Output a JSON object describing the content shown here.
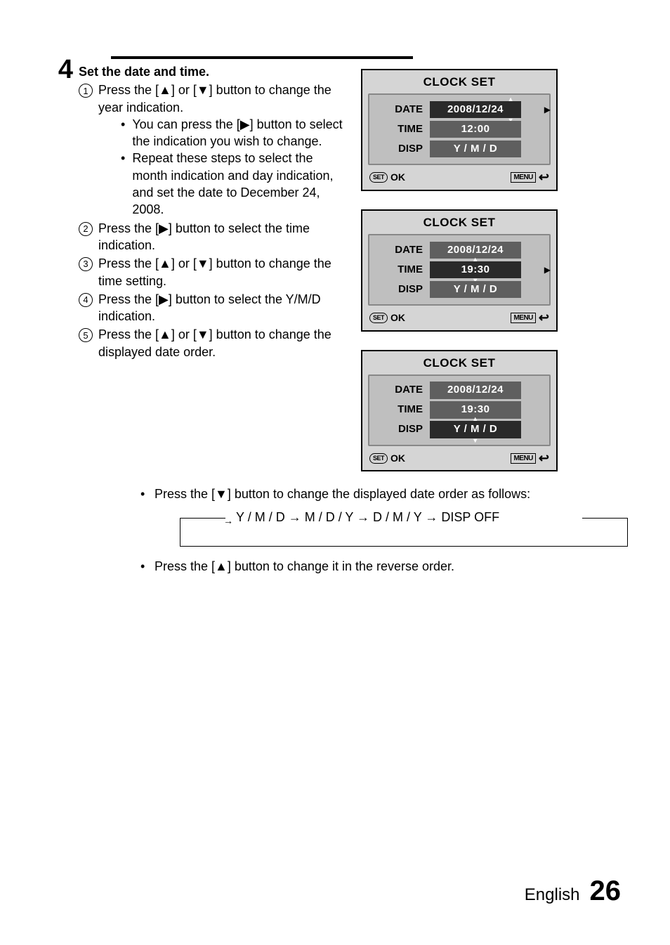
{
  "step": {
    "number": "4",
    "title": "Set the date and time.",
    "items": [
      {
        "n": "1",
        "text": "Press the [▲] or [▼] button to change the year indication.",
        "sub": [
          "You can press the [▶] button to select the indication you wish to change.",
          "Repeat these steps to select the month indication and day indication, and set the date to December 24, 2008."
        ]
      },
      {
        "n": "2",
        "text": "Press the [▶] button to select the time indication."
      },
      {
        "n": "3",
        "text": "Press the [▲] or [▼] button to change the time setting."
      },
      {
        "n": "4",
        "text": "Press the [▶] button to select the Y/M/D indication."
      },
      {
        "n": "5",
        "text": "Press the [▲] or [▼] button to change the displayed date order."
      }
    ]
  },
  "screens": [
    {
      "title": "CLOCK SET",
      "rows": [
        {
          "label": "DATE",
          "value": "2008/12/24",
          "selected": true,
          "arrows": "day",
          "sideArrow": true
        },
        {
          "label": "TIME",
          "value": "12:00",
          "selected": false
        },
        {
          "label": "DISP",
          "value": "Y / M / D",
          "selected": false
        }
      ],
      "ok": "OK",
      "set": "SET",
      "menu": "MENU"
    },
    {
      "title": "CLOCK SET",
      "rows": [
        {
          "label": "DATE",
          "value": "2008/12/24",
          "selected": false
        },
        {
          "label": "TIME",
          "value": "19:30",
          "selected": true,
          "arrows": "center",
          "sideArrow": true
        },
        {
          "label": "DISP",
          "value": "Y / M / D",
          "selected": false
        }
      ],
      "ok": "OK",
      "set": "SET",
      "menu": "MENU"
    },
    {
      "title": "CLOCK SET",
      "rows": [
        {
          "label": "DATE",
          "value": "2008/12/24",
          "selected": false
        },
        {
          "label": "TIME",
          "value": "19:30",
          "selected": false
        },
        {
          "label": "DISP",
          "value": "Y / M / D",
          "selected": true,
          "arrows": "center"
        }
      ],
      "ok": "OK",
      "set": "SET",
      "menu": "MENU"
    }
  ],
  "notes": {
    "down": "Press the [▼] button to change the displayed date order as follows:",
    "cycle": "Y / M / D → M / D / Y → D / M / Y → DISP OFF",
    "up": "Press the [▲] button to change it in the reverse order."
  },
  "footer": {
    "lang": "English",
    "page": "26"
  }
}
